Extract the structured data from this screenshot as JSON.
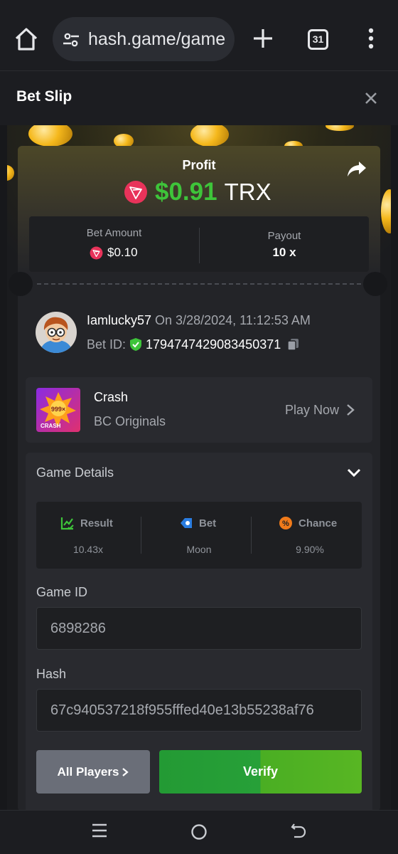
{
  "browser": {
    "url": "hash.game/game",
    "tab_count": "31"
  },
  "slip": {
    "title": "Bet Slip"
  },
  "profit": {
    "label": "Profit",
    "value": "$0.91",
    "currency": "TRX"
  },
  "stats": {
    "bet_amount_label": "Bet Amount",
    "bet_amount_value": "$0.10",
    "payout_label": "Payout",
    "payout_value": "10 x"
  },
  "user": {
    "username": "Iamlucky57",
    "date": " On 3/28/2024, 11:12:53 AM",
    "bet_id_label": "Bet ID:",
    "bet_id": "1794747429083450371"
  },
  "game": {
    "name": "Crash",
    "provider": "BC Originals",
    "play_label": "Play Now",
    "thumb_badge": "999×",
    "thumb_caption": "CRASH"
  },
  "details": {
    "title": "Game Details",
    "result_label": "Result",
    "result_value": "10.43x",
    "bet_label": "Bet",
    "bet_value": "Moon",
    "chance_label": "Chance",
    "chance_value": "9.90%"
  },
  "fields": {
    "game_id_label": "Game ID",
    "game_id_value": "6898286",
    "hash_label": "Hash",
    "hash_value": "67c940537218f955fffed40e13b55238af76"
  },
  "actions": {
    "players_label": "All Players",
    "verify_label": "Verify"
  },
  "colors": {
    "profit_green": "#3ec43a",
    "verify_green": "#27a038",
    "trx_red": "#e8335a"
  },
  "icons": [
    "home-icon",
    "tune-icon",
    "plus-icon",
    "tabs-icon",
    "more-vert-icon",
    "close-icon",
    "share-icon",
    "trx-icon",
    "verified-icon",
    "copy-icon",
    "chevron-right-icon",
    "chevron-down-icon",
    "result-icon",
    "bet-icon",
    "chance-icon",
    "recents-icon",
    "nav-home-icon",
    "back-icon"
  ]
}
